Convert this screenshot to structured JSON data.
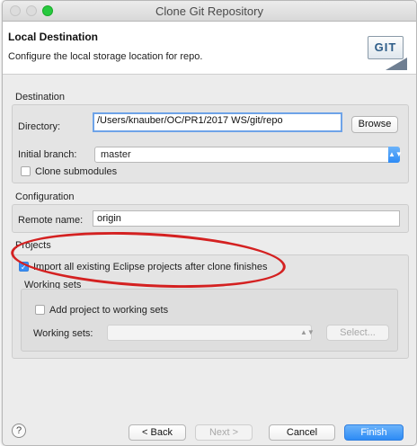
{
  "window": {
    "title": "Clone Git Repository"
  },
  "header": {
    "title": "Local Destination",
    "description": "Configure the local storage location for repo.",
    "logo_text": "GIT"
  },
  "destination": {
    "group_label": "Destination",
    "directory_label": "Directory:",
    "directory_value": "/Users/knauber/OC/PR1/2017 WS/git/repo",
    "browse_label": "Browse",
    "initial_branch_label": "Initial branch:",
    "initial_branch_value": "master",
    "clone_submodules_label": "Clone submodules",
    "clone_submodules_checked": false
  },
  "configuration": {
    "group_label": "Configuration",
    "remote_name_label": "Remote name:",
    "remote_name_value": "origin"
  },
  "projects": {
    "group_label": "Projects",
    "import_label": "Import all existing Eclipse projects after clone finishes",
    "import_checked": true,
    "working_sets_label": "Working sets",
    "add_to_working_sets_label": "Add project to working sets",
    "add_to_working_sets_checked": false,
    "working_sets_field_label": "Working sets:",
    "select_label": "Select..."
  },
  "footer": {
    "help_label": "?",
    "back_label": "< Back",
    "next_label": "Next >",
    "cancel_label": "Cancel",
    "finish_label": "Finish"
  },
  "colors": {
    "accent": "#2d8bf5",
    "annotation": "#d42121"
  }
}
